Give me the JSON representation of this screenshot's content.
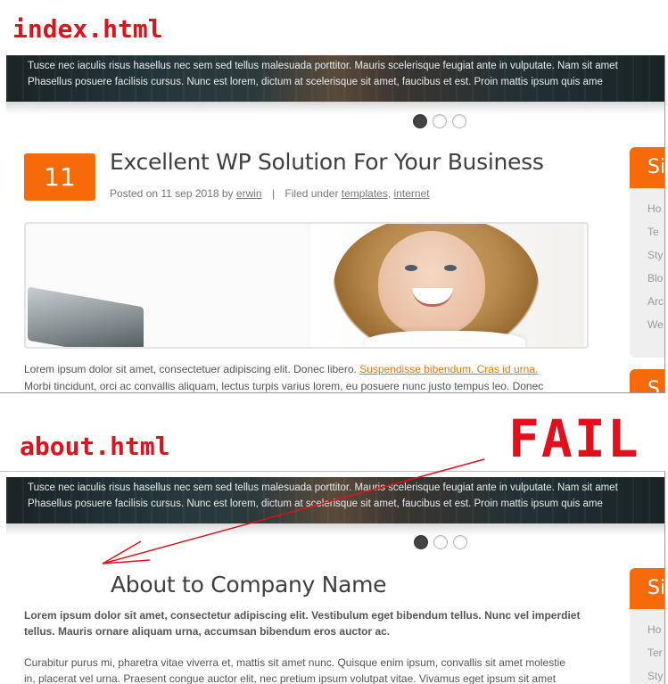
{
  "labels": {
    "index": "index.html",
    "about": "about.html",
    "fail": "FAIL"
  },
  "hero": {
    "line1": "Tusce nec iaculis risus hasellus nec sem sed tellus malesuada porttitor. Mauris scelerisque feugiat ante in vulputate. Nam sit amet",
    "line2": "Phasellus posuere facilisis cursus. Nunc est lorem, dictum at scelerisque sit amet, faucibus et est. Proin mattis ipsum quis ame"
  },
  "index_page": {
    "date_day": "11",
    "post_title": "Excellent WP Solution For Your Business",
    "meta_posted": "Posted on 11 sep 2018 by",
    "meta_author": "erwin",
    "meta_sep": "|",
    "meta_filed": "Filed under",
    "meta_cat1": "templates",
    "meta_comma": ",",
    "meta_cat2": "internet",
    "body_line1_prefix": "Lorem ipsum dolor sit amet, consectetuer adipiscing elit. Donec libero.",
    "body_line1_link": "Suspendisse bibendum. Cras id urna.",
    "body_line2": "Morbi tincidunt, orci ac convallis aliquam, lectus turpis varius lorem, eu posuere nunc justo tempus leo. Donec",
    "sidebar_head": "Si",
    "sidebar_items": [
      "Ho",
      "Te",
      "Sty",
      "Blo",
      "Arc",
      "We"
    ],
    "sidebar_head2": "S"
  },
  "about_page": {
    "title": "About to Company Name",
    "bold_text": "Lorem ipsum dolor sit amet, consectetur adipiscing elit. Vestibulum eget bibendum tellus. Nunc vel imperdiet tellus. Mauris ornare aliquam urna, accumsan bibendum eros auctor ac.",
    "text_line1": "Curabitur purus mi, pharetra vitae viverra et, mattis sit amet nunc. Quisque enim ipsum, convallis sit amet molestie",
    "text_line2": "in, placerat vel urna. Praesent congue auctor elit, nec pretium ipsum volutpat vitae. Vivamus eget ipsum sit amet",
    "sidebar_head": "Si",
    "sidebar_items": [
      "Ho",
      "Ter",
      "Sty"
    ]
  },
  "colors": {
    "accent": "#f66a0a",
    "annotation": "#e3101b",
    "link": "#e8760c"
  }
}
